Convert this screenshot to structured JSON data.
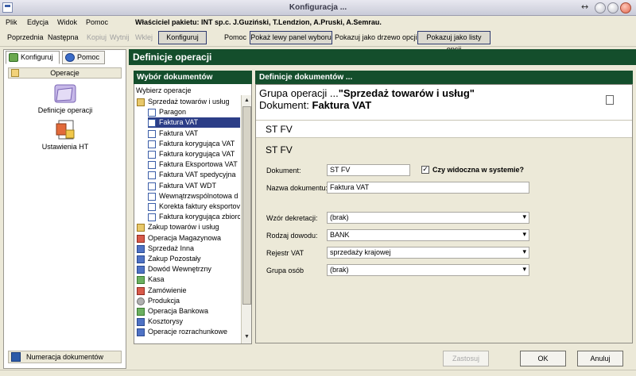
{
  "window": {
    "title": "Konfiguracja ..."
  },
  "menu": {
    "items": [
      "Plik",
      "Edycja",
      "Widok",
      "Pomoc"
    ],
    "owner": "Właściciel pakietu: INT sp.c. J.Guziński, T.Lendzion, A.Pruski, A.Semrau."
  },
  "toolbar": {
    "prev": "Poprzednia",
    "next": "Następna",
    "copy": "Kopiuj",
    "cut": "Wytnij",
    "paste": "Wklej",
    "configure": "Konfiguruj",
    "help": "Pomoc",
    "show_left": "Pokaż lewy panel wyboru",
    "show_tree": "Pokazuj jako drzewo opcji",
    "show_list": "Pokazuj jako listy opcji"
  },
  "sidebar": {
    "tabs": [
      "Konfiguruj",
      "Pomoc"
    ],
    "section": "Operacje",
    "items": [
      {
        "label": "Definicje operacji",
        "icon": "folder-icon"
      },
      {
        "label": "Ustawienia HT",
        "icon": "settings-doc-icon"
      }
    ],
    "footer": "Numeracja dokumentów"
  },
  "main": {
    "title": "Definicje operacji"
  },
  "chooser": {
    "title": "Wybór dokumentów",
    "label": "Wybierz operacje",
    "items": [
      {
        "label": "Sprzedaż towarów i usług",
        "level": 0,
        "icon": "folder"
      },
      {
        "label": "Paragon",
        "level": 1,
        "icon": "doc"
      },
      {
        "label": "Faktura VAT",
        "level": 1,
        "icon": "doc",
        "selected": true
      },
      {
        "label": "Faktura VAT",
        "level": 1,
        "icon": "doc"
      },
      {
        "label": "Faktura korygująca VAT",
        "level": 1,
        "icon": "doc"
      },
      {
        "label": "Faktura korygująca VAT",
        "level": 1,
        "icon": "doc"
      },
      {
        "label": "Faktura Eksportowa VAT",
        "level": 1,
        "icon": "doc"
      },
      {
        "label": "Faktura VAT spedycyjna",
        "level": 1,
        "icon": "doc"
      },
      {
        "label": "Faktura VAT WDT",
        "level": 1,
        "icon": "doc"
      },
      {
        "label": "Wewnątrzwspólnotowa d",
        "level": 1,
        "icon": "doc"
      },
      {
        "label": "Korekta faktury eksportov",
        "level": 1,
        "icon": "doc"
      },
      {
        "label": "Faktura korygująca zbiorc",
        "level": 1,
        "icon": "doc"
      },
      {
        "label": "Zakup towarów i usług",
        "level": 0,
        "icon": "folder"
      },
      {
        "label": "Operacja Magazynowa",
        "level": 0,
        "icon": "red"
      },
      {
        "label": "Sprzedaż Inna",
        "level": 0,
        "icon": "blue"
      },
      {
        "label": "Zakup Pozostały",
        "level": 0,
        "icon": "blue"
      },
      {
        "label": "Dowód Wewnętrzny",
        "level": 0,
        "icon": "blue"
      },
      {
        "label": "Kasa",
        "level": 0,
        "icon": "green"
      },
      {
        "label": "Zamówienie",
        "level": 0,
        "icon": "red"
      },
      {
        "label": "Produkcja",
        "level": 0,
        "icon": "grey"
      },
      {
        "label": "Operacja Bankowa",
        "level": 0,
        "icon": "green"
      },
      {
        "label": "Kosztorysy",
        "level": 0,
        "icon": "blue"
      },
      {
        "label": "Operacje rozrachunkowe",
        "level": 0,
        "icon": "blue"
      }
    ]
  },
  "definition": {
    "title": "Definicje dokumentów ...",
    "group_prefix": "Grupa operacji ...",
    "group_name": "\"Sprzedaż towarów i usług\"",
    "doc_prefix": "Dokument:",
    "doc_name": "Faktura VAT",
    "code": "ST FV",
    "code2": "ST FV",
    "fields": {
      "dokument_label": "Dokument:",
      "dokument_value": "ST FV",
      "visible_label": "Czy widoczna w systemie?",
      "visible_checked": "✓",
      "nazwa_label": "Nazwa dokumentu:",
      "nazwa_value": "Faktura VAT",
      "wzor_label": "Wzór dekretacji:",
      "wzor_value": "(brak)",
      "rodzaj_label": "Rodzaj dowodu:",
      "rodzaj_value": "BANK",
      "rejestr_label": "Rejestr VAT",
      "rejestr_value": "sprzedaży krajowej",
      "grupa_label": "Grupa osób",
      "grupa_value": "(brak)"
    }
  },
  "buttons": {
    "apply": "Zastosuj",
    "ok": "OK",
    "cancel": "Anuluj"
  }
}
